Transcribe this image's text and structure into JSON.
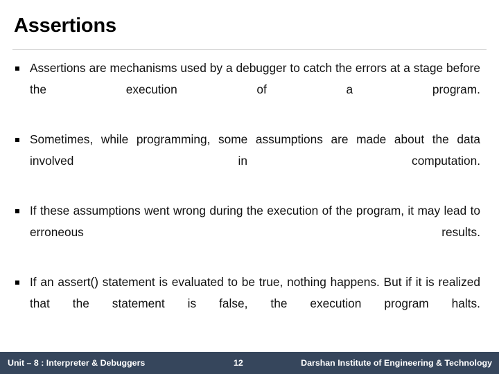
{
  "slide": {
    "title": "Assertions",
    "bullet_marker_glyph": "square-bullet",
    "bullets": [
      {
        "text": "Assertions are mechanisms used by a debugger to catch the errors at a stage before the execution of a program."
      },
      {
        "text": "Sometimes, while programming, some assumptions are made about the data involved in computation."
      },
      {
        "text": "If these assumptions went wrong during the execution of the program, it may lead to erroneous results."
      },
      {
        "text": "If an assert() statement is evaluated to be true, nothing happens. But if it is realized that the statement is false, the execution program halts."
      }
    ]
  },
  "footer": {
    "unit_label": "Unit – 8 : Interpreter & Debuggers",
    "page_number": "12",
    "institute": "Darshan Institute of Engineering & Technology",
    "background_color": "#36465c",
    "text_color": "#ffffff"
  },
  "colors": {
    "title_text": "#000000",
    "body_text": "#111111",
    "rule": "#d9d9d9",
    "slide_background": "#ffffff"
  }
}
